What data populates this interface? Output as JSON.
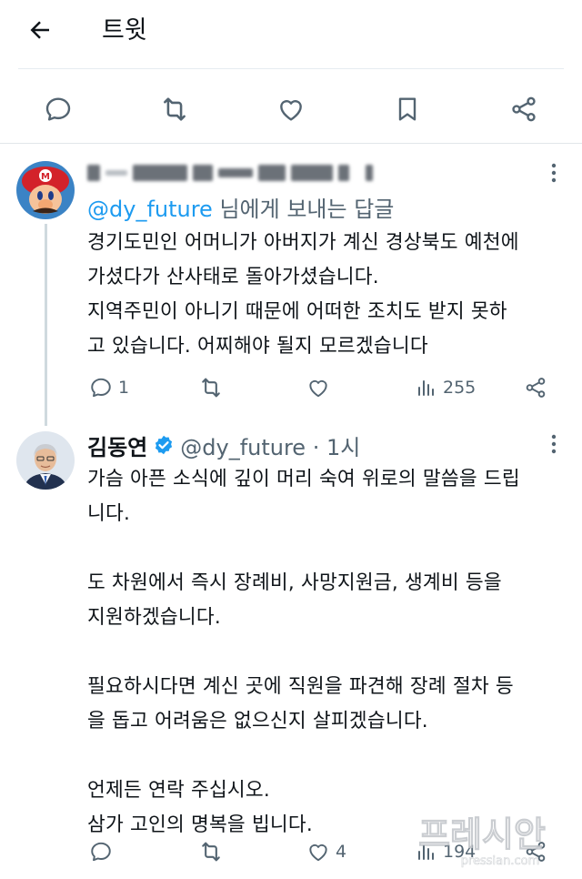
{
  "header": {
    "title": "트윗"
  },
  "reply": {
    "reply_prefix": "@dy_future",
    "reply_suffix": " 님에게 보내는 답글",
    "text": "경기도민인 어머니가 아버지가 계신 경상북도 예천에\n가셨다가 산사태로 돌아가셨습니다.\n지역주민이 아니기 때문에 어떠한 조치도 받지 못하\n고 있습니다. 어찌해야 될지 모르겠습니다",
    "replies": "1",
    "retweets": "",
    "likes": "",
    "views": "255"
  },
  "main_tweet": {
    "name": "김동연",
    "handle_time": "@dy_future · 1시",
    "text": "가슴 아픈 소식에 깊이 머리 숙여 위로의 말씀을 드립\n니다.\n\n도 차원에서 즉시 장례비, 사망지원금, 생계비 등을\n지원하겠습니다.\n\n필요하시다면 계신 곳에 직원을 파견해 장례 절차 등\n을 돕고 어려움은 없으신지 살피겠습니다.\n\n언제든 연락 주십시오.\n삼가 고인의 명복을 빕니다.",
    "replies": "",
    "retweets": "",
    "likes": "4",
    "views": "194"
  },
  "watermark": {
    "text": "프레시안",
    "url": "pressian.com"
  },
  "colors": {
    "accent": "#1d9bf0",
    "muted": "#536471",
    "text": "#0f1419",
    "divider": "#e1e6ea"
  }
}
